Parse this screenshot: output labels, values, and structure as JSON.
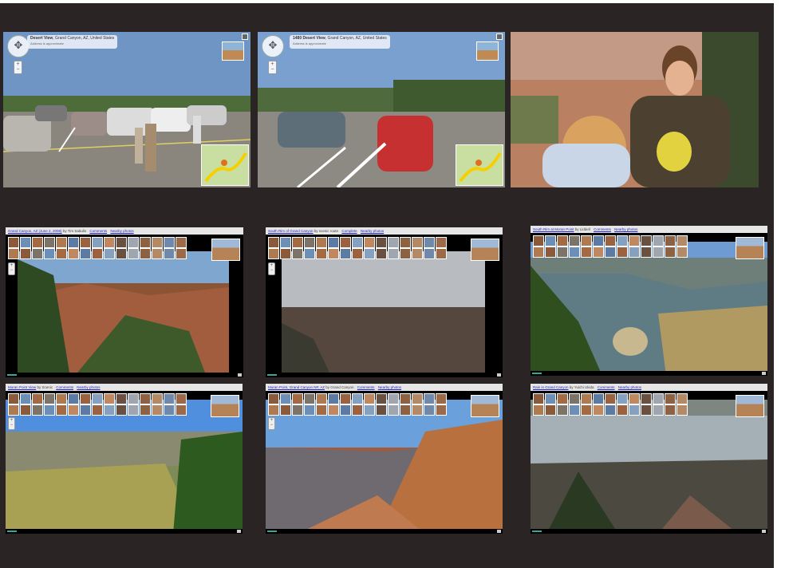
{
  "street_view": {
    "left": {
      "title_bold": "Desert View",
      "title_rest": ", Grand Canyon, AZ, United States",
      "subtitle": "Address is approximate"
    },
    "middle": {
      "title_bold": "1480 Desert View",
      "title_rest": ", Grand Canyon, AZ, United States",
      "subtitle": "Address is approximate"
    }
  },
  "panoramio": {
    "p1": {
      "title": "Grand Canyon, AZ (June 2, 2008)",
      "by": "by Tim Sabulis",
      "links": [
        "Comments",
        "Nearby photos"
      ]
    },
    "p2": {
      "title": "South Rim of Grand Canyon",
      "by": "by scenic route",
      "links": [
        "Complete",
        "Nearby photos"
      ]
    },
    "p3": {
      "title": "South Rim at Moran Point",
      "by": "by Liddell",
      "links": [
        "Comments",
        "Nearby photos"
      ]
    },
    "p4": {
      "title": "Moran Point View",
      "by": "by Scenic",
      "links": [
        "Comments",
        "Nearby photos"
      ]
    },
    "p5": {
      "title": "Moran Point, Grand Canyon NP, AZ",
      "by": "by Grand Canyon",
      "links": [
        "Comments",
        "Nearby photos"
      ]
    },
    "p6": {
      "title": "Rain in Grand Canyon",
      "by": "by Yuichi Ukida",
      "links": [
        "Comments",
        "Nearby photos"
      ]
    }
  },
  "colors": {
    "background": "#2a2524",
    "panoramio_link": "#2222cc"
  }
}
